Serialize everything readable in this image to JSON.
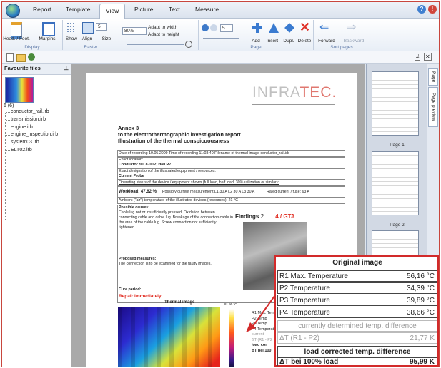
{
  "ribbon_tabs": [
    "Report",
    "Template",
    "View",
    "Picture",
    "Text",
    "Measure"
  ],
  "active_tab": "View",
  "ribbon": {
    "display": {
      "head_foot": "Head. / Foot.",
      "margins": "Margins",
      "label": "Display"
    },
    "raster": {
      "show": "Show",
      "align": "Align",
      "size": "Size",
      "spin_value": "5",
      "label": "Raster"
    },
    "zoom": {
      "value": "80%",
      "adapt_width": "Adapt to width",
      "adapt_height": "Adapt to height"
    },
    "page": {
      "spin_value": "5",
      "add": "Add",
      "insert": "Insert",
      "dupl": "Dupl.",
      "delete": "Delete",
      "label": "Page"
    },
    "sort": {
      "forward": "Forward",
      "backward": "Backward",
      "label": "Sort pages"
    }
  },
  "favourites": {
    "title": "Favourite files",
    "count": "6 (6)",
    "files": [
      "conductor_rail.irb",
      "transmission.irb",
      "engine.irb",
      "engine_inspection.irb",
      "system03.irb",
      "ELT02.irb"
    ]
  },
  "page_panel": {
    "tabs": [
      "Page",
      "Page preview"
    ],
    "pages": [
      "Page 1",
      "Page 2"
    ]
  },
  "report": {
    "logo_a": "INFRA",
    "logo_b": "TEC.",
    "annex": "Annex 3",
    "subtitle": "to the electrothermographic investigation report",
    "title": "Illustration of the thermal conspicuousness",
    "row1": "Date of recording    19.05.2009    Time of recording    11:03:40    Filename of thermal image    conductor_rail.irb",
    "row2a": "Exact location:",
    "row2b": "Conductor rail 87012, Hall R7",
    "row3a": "Exact designation of the illustrated equipment / resources:",
    "row3b": "Current Probe",
    "row4": "Operating status of the device / equipment shown (full load, half load, 30% utilization or similar):",
    "row5a": "Workload:  47,62 %",
    "row5b": "Possibly current measurement    L1  30 A   L2  30 A   L3  30 A",
    "row5c": "Rated current / fuse:  63 A",
    "row6": "Ambient (\"air\") temperature of the illustrated devices (resources):   21 °C",
    "causes_title": "Possible causes:",
    "causes": "Cable lug not or insufficiently pressed. Oxidation between connecting cable and cable lug. Breakage of the connection cable in the area of the cable lug. Screw connection not sufficiently tightened.",
    "findings": "Findings",
    "findings_num": "2",
    "findings_code": "4 / GTA",
    "measures_title": "Proposed measures:",
    "measures": "The connection is to be examined for the faulty images.",
    "cure_title": "Cure period:",
    "cure": "Repair immediately",
    "thermal_label": "Thermal image",
    "scale_max": "81.90 °C",
    "small_rows": [
      "R1 Max. Tem",
      "P2 Temp",
      "P3 Temp",
      "P4 Temperat",
      "current",
      "ΔT (R1 - P2",
      "load cor",
      "ΔT bei 100"
    ]
  },
  "overlay": {
    "title": "Original image",
    "rows": [
      {
        "label": "R1 Max. Temperature",
        "value": "56,16 °C"
      },
      {
        "label": "P2 Temperature",
        "value": "34,39 °C"
      },
      {
        "label": "P3 Temperature",
        "value": "39,89 °C"
      },
      {
        "label": "P4 Temperature",
        "value": "38,66 °C"
      }
    ],
    "diff_title": "currently determined temp. difference",
    "diff_label": "ΔT (R1 - P2)",
    "diff_value": "21,77 K",
    "load_title": "load corrected temp. difference",
    "load_label": "ΔT bei 100% load",
    "load_value": "95,99 K"
  }
}
